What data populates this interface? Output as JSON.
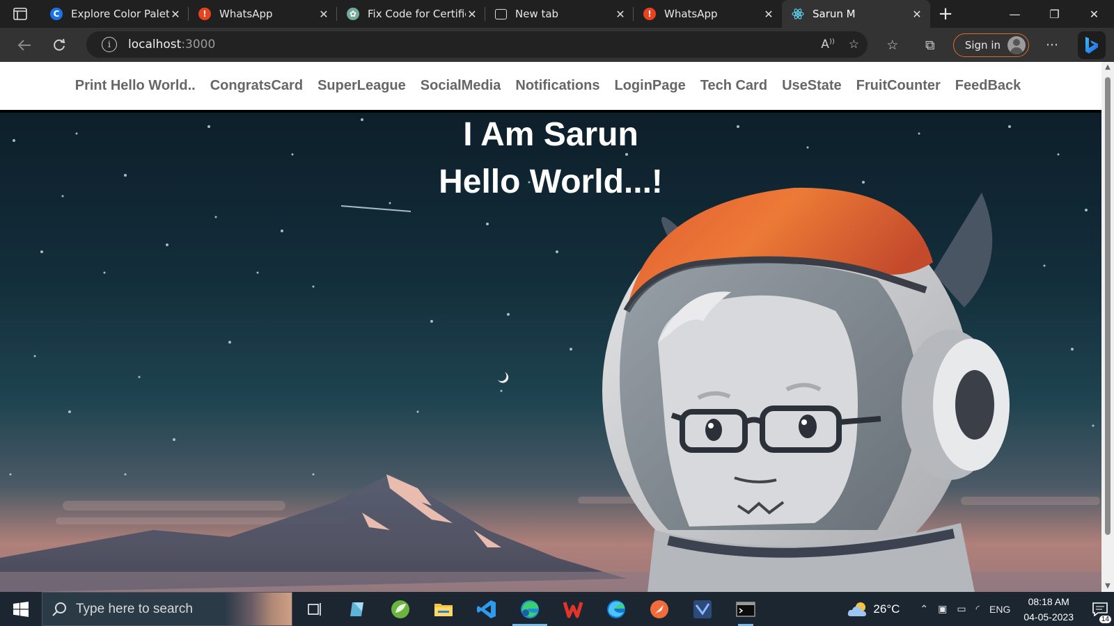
{
  "browser": {
    "tabs": [
      {
        "title": "Explore Color Palett",
        "favicon": "chrome-blue-icon",
        "color": "#1a73e8"
      },
      {
        "title": "WhatsApp",
        "favicon": "alert-icon",
        "color": "#e8431f"
      },
      {
        "title": "Fix Code for Certific",
        "favicon": "chatgpt-icon",
        "color": "#74aa9c"
      },
      {
        "title": "New tab",
        "favicon": "newtab-icon",
        "color": "#444"
      },
      {
        "title": "WhatsApp",
        "favicon": "alert-icon",
        "color": "#e8431f"
      },
      {
        "title": "Sarun M",
        "favicon": "react-icon",
        "color": "#61dafb"
      }
    ],
    "active_tab_index": 5,
    "address": {
      "host": "localhost",
      "port": ":3000"
    },
    "signin_label": "Sign in",
    "accent_color": "#e06a2b"
  },
  "page": {
    "nav_links": [
      "Print Hello World..",
      "CongratsCard",
      "SuperLeague",
      "SocialMedia",
      "Notifications",
      "LoginPage",
      "Tech Card",
      "UseState",
      "FruitCounter",
      "FeedBack"
    ],
    "hero": {
      "title": "I Am Sarun",
      "subtitle": "Hello World...!"
    }
  },
  "taskbar": {
    "search_placeholder": "Type here to search",
    "apps": [
      "task-view-icon",
      "notes-icon",
      "spring-icon",
      "file-explorer-icon",
      "vscode-icon",
      "edge-dev-icon",
      "wps-icon",
      "edge-icon",
      "postman-icon",
      "vpn-icon",
      "terminal-icon"
    ],
    "weather": "26°C",
    "language": "ENG",
    "time": "08:18 AM",
    "date": "04-05-2023",
    "notification_count": "14"
  }
}
